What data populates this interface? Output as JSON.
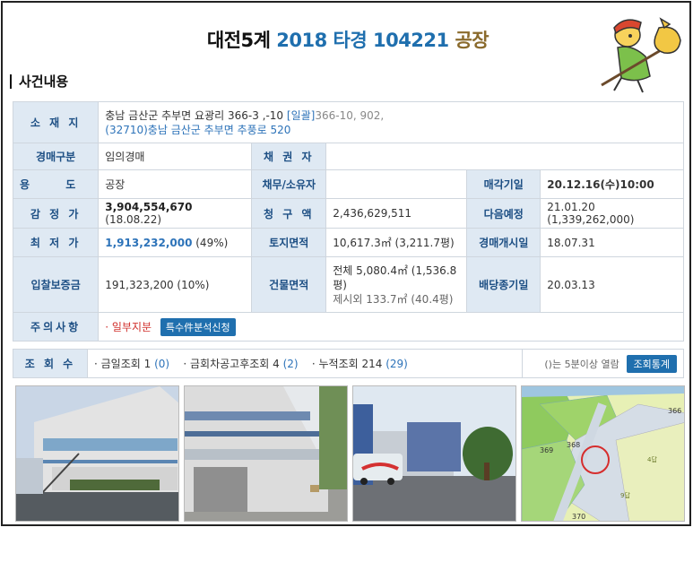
{
  "title": {
    "court": "대전5계",
    "case": "2018 타경 104221",
    "type": "공장"
  },
  "section": "사건내용",
  "rows": {
    "location": {
      "label": "소 재 지",
      "address1": "충남 금산군 추부면 요광리 366-3 ,-10",
      "bulk_tag": "[일괄]",
      "bulk": "366-10, 902,",
      "address2": "(32710)충남 금산군  추부면 추풍로  520"
    },
    "auction_type": {
      "label": "경매구분",
      "value": "임의경매"
    },
    "creditor": {
      "label": "채 권 자",
      "value": ""
    },
    "usage": {
      "label": "용 도",
      "value": "공장"
    },
    "debtor": {
      "label": "채무/소유자",
      "value": ""
    },
    "sale_date": {
      "label": "매각기일",
      "value": "20.12.16(수)10:00"
    },
    "appraisal": {
      "label": "감 정 가",
      "value": "3,904,554,670",
      "extra": " (18.08.22)"
    },
    "claim": {
      "label": "청 구 액",
      "value": "2,436,629,511"
    },
    "next_schedule": {
      "label": "다음예정",
      "value": "21.01.20 (1,339,262,000)"
    },
    "minimum": {
      "label": "최 저 가",
      "value": "1,913,232,000",
      "extra": " (49%)"
    },
    "land_area": {
      "label": "토지면적",
      "value": "10,617.3㎡ (3,211.7평)"
    },
    "start_date": {
      "label": "경매개시일",
      "value": "18.07.31"
    },
    "deposit": {
      "label": "입찰보증금",
      "value": "191,323,200 (10%)"
    },
    "building_area": {
      "label": "건물면적",
      "line1": "전체 5,080.4㎡ (1,536.8",
      "line2": "평)",
      "line3": "제시외 133.7㎡ (40.4평)"
    },
    "dividend_date": {
      "label": "배당종기일",
      "value": "20.03.13"
    },
    "notes": {
      "label": "주의사항",
      "value": "· 일부지분",
      "badge": "특수件분석신청"
    }
  },
  "views": {
    "label": "조 회 수",
    "today_label": "· 금일조회",
    "today_count": "1",
    "today_sub": "(0)",
    "since_label": "· 금회차공고후조회",
    "since_count": "4",
    "since_sub": "(2)",
    "total_label": "· 누적조회",
    "total_count": "214",
    "total_sub": "(29)",
    "note": "()는 5분이상 열람",
    "button": "조회통계"
  },
  "map_labels": [
    "366",
    "369",
    "368",
    "370",
    "4답",
    "9답"
  ],
  "colors": {
    "label_bg": "#dfe9f3",
    "label_text": "#1d4f84",
    "accent": "#1f6fae",
    "red": "#d0312d"
  }
}
